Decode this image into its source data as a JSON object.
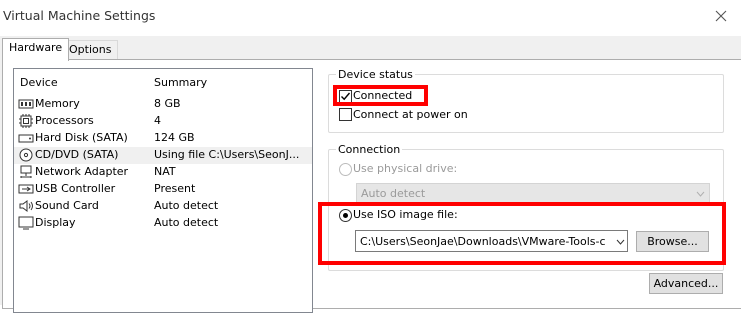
{
  "window": {
    "title": "Virtual Machine Settings"
  },
  "tabs": [
    {
      "label": "Hardware"
    },
    {
      "label": "Options"
    }
  ],
  "device_list": {
    "headers": {
      "device": "Device",
      "summary": "Summary"
    },
    "rows": [
      {
        "icon": "memory-icon",
        "device": "Memory",
        "summary": "8 GB"
      },
      {
        "icon": "processor-icon",
        "device": "Processors",
        "summary": "4"
      },
      {
        "icon": "hard-disk-icon",
        "device": "Hard Disk (SATA)",
        "summary": "124 GB"
      },
      {
        "icon": "cd-dvd-icon",
        "device": "CD/DVD (SATA)",
        "summary": "Using file C:\\Users\\SeonJ..."
      },
      {
        "icon": "network-adapter-icon",
        "device": "Network Adapter",
        "summary": "NAT"
      },
      {
        "icon": "usb-icon",
        "device": "USB Controller",
        "summary": "Present"
      },
      {
        "icon": "sound-card-icon",
        "device": "Sound Card",
        "summary": "Auto detect"
      },
      {
        "icon": "display-icon",
        "device": "Display",
        "summary": "Auto detect"
      }
    ]
  },
  "device_status": {
    "title": "Device status",
    "connected_label": "Connected",
    "connected_checked": true,
    "connect_at_power_on_label": "Connect at power on",
    "connect_at_power_on_checked": false
  },
  "connection": {
    "title": "Connection",
    "physical_drive_label": "Use physical drive:",
    "physical_drive_value": "Auto detect",
    "iso_label": "Use ISO image file:",
    "iso_path": "C:\\Users\\SeonJae\\Downloads\\VMware-Tools-c",
    "browse_label": "Browse...",
    "selected": "iso"
  },
  "advanced_label": "Advanced...",
  "colors": {
    "highlight": "#ff0000"
  }
}
